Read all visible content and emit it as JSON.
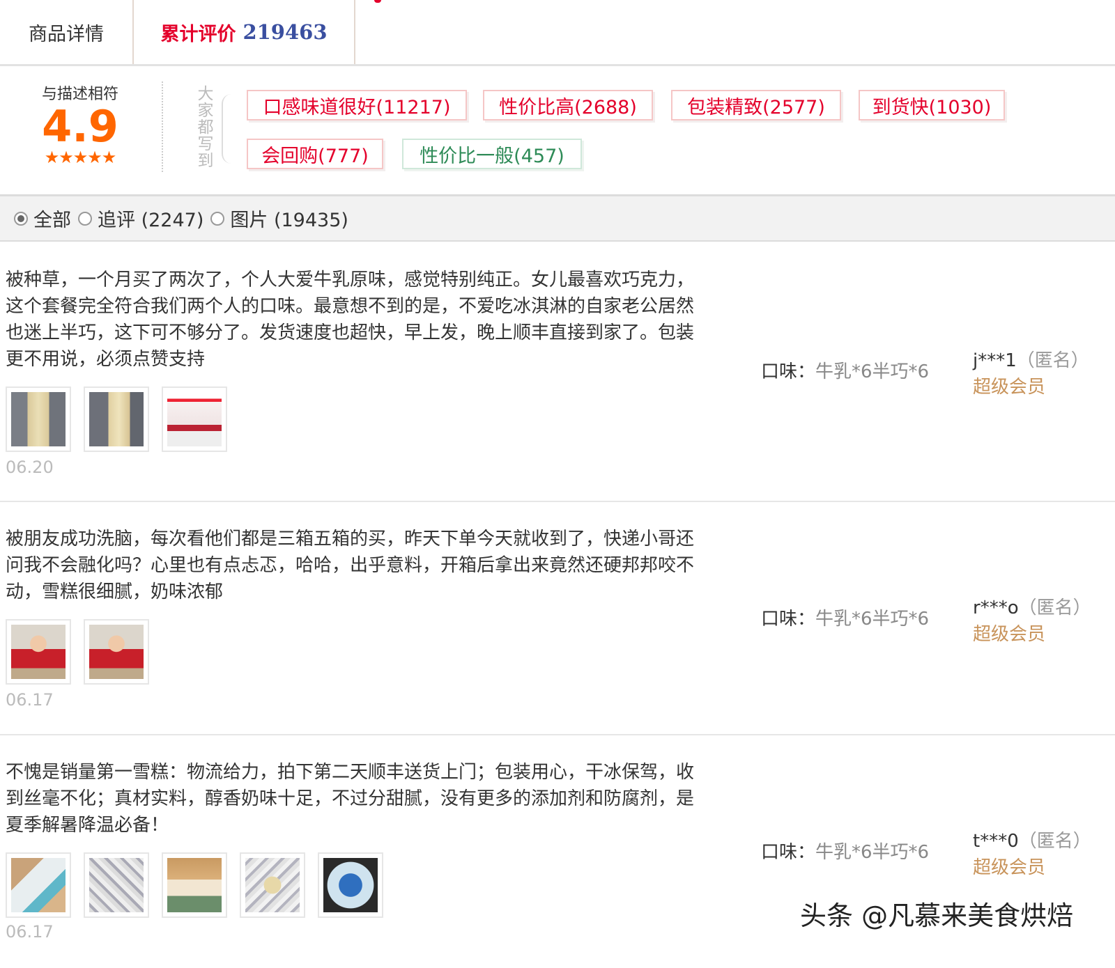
{
  "tabs": {
    "details_label": "商品详情",
    "reviews_label": "累计评价",
    "reviews_count": "219463"
  },
  "rating": {
    "label": "与描述相符",
    "score": "4.9",
    "stars": "★★★★★",
    "stars_value": 5
  },
  "tags_header": "大家都写到",
  "tags": [
    {
      "label": "口感味道很好(11217)",
      "sentiment": "positive"
    },
    {
      "label": "性价比高(2688)",
      "sentiment": "positive"
    },
    {
      "label": "包装精致(2577)",
      "sentiment": "positive"
    },
    {
      "label": "到货快(1030)",
      "sentiment": "positive"
    },
    {
      "label": "会回购(777)",
      "sentiment": "positive"
    },
    {
      "label": "性价比一般(457)",
      "sentiment": "neutral"
    }
  ],
  "filters": [
    {
      "label": "全部",
      "selected": true
    },
    {
      "label": "追评 (2247)",
      "selected": false
    },
    {
      "label": "图片 (19435)",
      "selected": false
    }
  ],
  "reviews": [
    {
      "text": "被种草，一个月买了两次了，个人大爱牛乳原味，感觉特别纯正。女儿最喜欢巧克力，这个套餐完全符合我们两个人的口味。最意想不到的是，不爱吃冰淇淋的自家老公居然也迷上半巧，这下可不够分了。发货速度也超快，早上发，晚上顺丰直接到家了。包装更不用说，必须点赞支持",
      "date": "06.20",
      "spec_label": "口味：",
      "spec_value": "牛乳*6半巧*6",
      "user": "j***1",
      "anon": "（匿名）",
      "level": "超级会员"
    },
    {
      "text": "被朋友成功洗脑，每次看他们都是三箱五箱的买，昨天下单今天就收到了，快递小哥还问我不会融化吗？心里也有点忐忑，哈哈，出乎意料，开箱后拿出来竟然还硬邦邦咬不动，雪糕很细腻，奶味浓郁",
      "date": "06.17",
      "spec_label": "口味：",
      "spec_value": "牛乳*6半巧*6",
      "user": "r***o",
      "anon": "（匿名）",
      "level": "超级会员"
    },
    {
      "text": "不愧是销量第一雪糕：物流给力，拍下第二天顺丰送货上门；包装用心，干冰保驾，收到丝毫不化；真材实料，醇香奶味十足，不过分甜腻，没有更多的添加剂和防腐剂，是夏季解暑降温必备！",
      "date": "06.17",
      "spec_label": "口味：",
      "spec_value": "牛乳*6半巧*6",
      "user": "t***0",
      "anon": "（匿名）",
      "level": "超级会员"
    }
  ],
  "watermark": "头条 @凡慕来美食烘焙"
}
